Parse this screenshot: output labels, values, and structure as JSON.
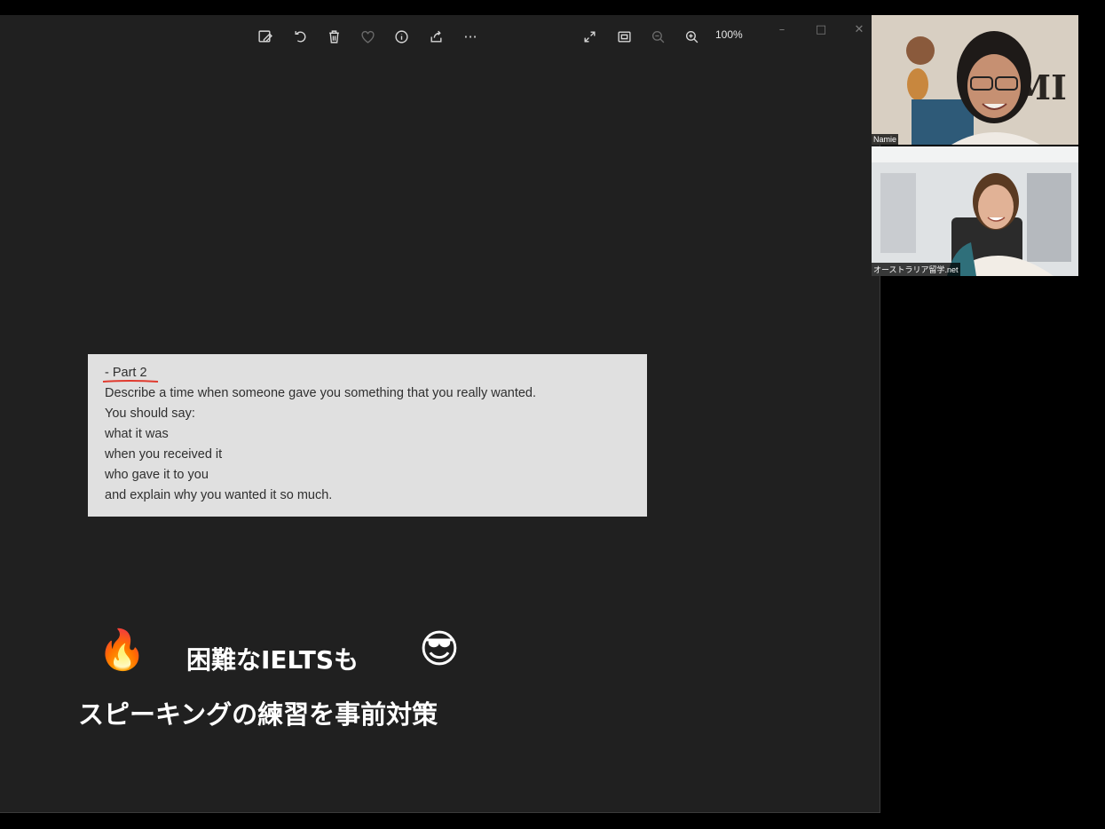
{
  "toolbar": {
    "icons": [
      "edit-image-icon",
      "rotate-icon",
      "delete-icon",
      "favorite-icon",
      "info-icon",
      "share-icon",
      "more-icon"
    ],
    "more_label": "···",
    "zoom_percent": "100%"
  },
  "window_controls": {
    "minimize": "–",
    "maximize": "□",
    "close": "✕"
  },
  "document": {
    "heading": "- Part 2",
    "lines": [
      "Describe a time when someone gave you something that you really wanted.",
      "You should say:",
      "what it was",
      "when you received it",
      "who gave it to you",
      "and explain why you wanted it so much."
    ],
    "underline_color": "#e03a2e"
  },
  "caption": {
    "line1": "困難なIELTSも",
    "line2": "スピーキングの練習を事前対策",
    "emoji_left": "🔥",
    "emoji_right": "😎"
  },
  "participants": [
    {
      "name": "Namie"
    },
    {
      "name": "オーストラリア留学.net"
    }
  ]
}
